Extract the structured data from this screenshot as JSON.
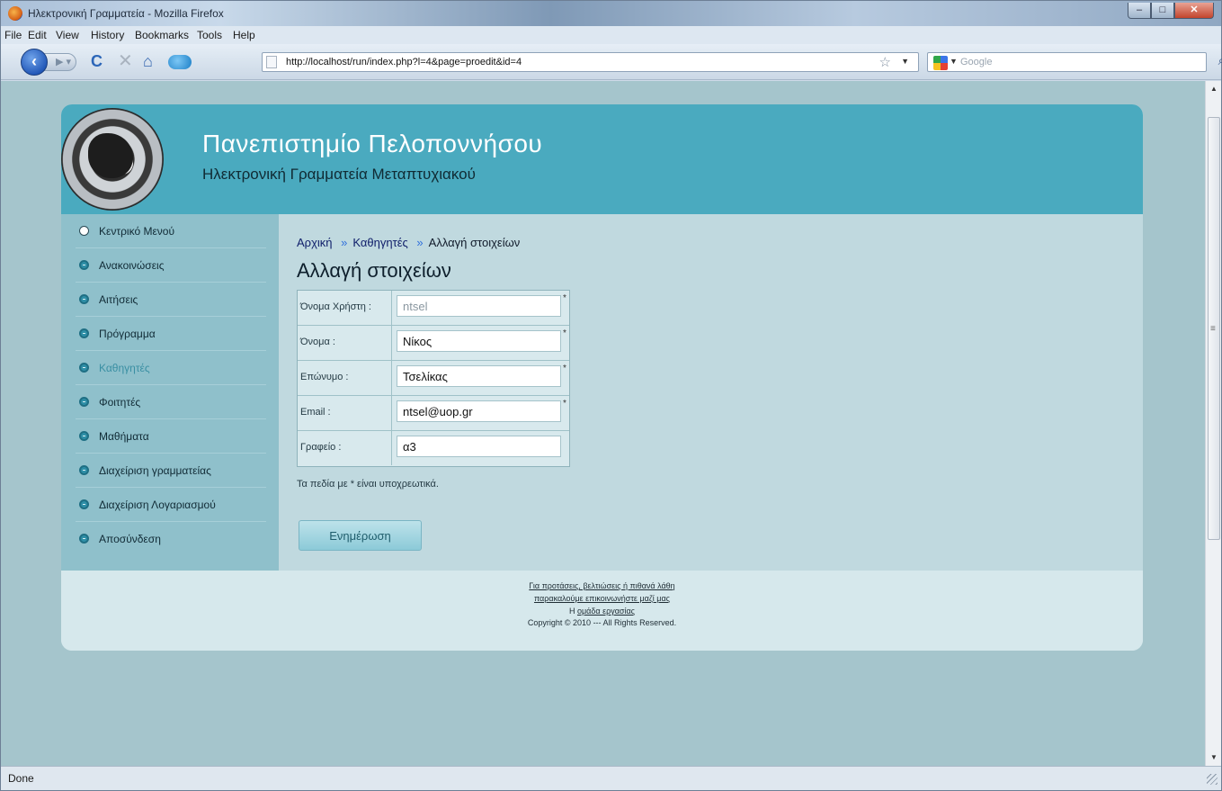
{
  "window": {
    "title": "Ηλεκτρονική Γραμματεία - Mozilla Firefox",
    "controls": {
      "minimize": "–",
      "maximize": "□",
      "close": "✕"
    }
  },
  "menubar": [
    "File",
    "Edit",
    "View",
    "History",
    "Bookmarks",
    "Tools",
    "Help"
  ],
  "navbar": {
    "url": "http://localhost/run/index.php?l=4&page=proedit&id=4",
    "search_placeholder": "Google",
    "icons": [
      "back-icon",
      "forward-icon",
      "reload-icon",
      "stop-icon",
      "home-icon",
      "chat-icon",
      "bookmark-star-icon",
      "search-icon"
    ]
  },
  "site": {
    "title": "Πανεπιστημίο Πελοποννήσου",
    "subtitle": "Ηλεκτρονική Γραμματεία Μεταπτυχιακού"
  },
  "sidebar": {
    "items": [
      {
        "label": "Κεντρικό Μενού"
      },
      {
        "label": "Ανακοινώσεις"
      },
      {
        "label": "Αιτήσεις"
      },
      {
        "label": "Πρόγραμμα"
      },
      {
        "label": "Καθηγητές"
      },
      {
        "label": "Φοιτητές"
      },
      {
        "label": "Μαθήματα"
      },
      {
        "label": "Διαχείριση γραμματείας"
      },
      {
        "label": "Διαχείριση Λογαριασμού"
      },
      {
        "label": "Αποσύνδεση"
      }
    ]
  },
  "breadcrumb": {
    "home": "Αρχική",
    "sep1": "»",
    "section": "Καθηγητές",
    "sep2": "»",
    "current": "Αλλαγή στοιχείων"
  },
  "page_title": "Αλλαγή στοιχείων",
  "form": {
    "fields": [
      {
        "label": "Όνομα Χρήστη :",
        "value": "ntsel",
        "required": "*"
      },
      {
        "label": "Όνομα :",
        "value": "Νίκος",
        "required": "*"
      },
      {
        "label": "Επώνυμο :",
        "value": "Τσελίκας",
        "required": "*"
      },
      {
        "label": "Email :",
        "value": "ntsel@uop.gr",
        "required": "*"
      },
      {
        "label": "Γραφείο :",
        "value": "α3",
        "required": ""
      }
    ],
    "note": "Τα πεδία με * είναι υποχρεωτικά.",
    "submit_label": "Ενημέρωση"
  },
  "footer": {
    "line1": "Για προτάσεις, βελτιώσεις ή πιθανά λάθη",
    "line2": "παρακαλούμε επικοινωνήστε μαζί μας",
    "line3_prefix": "Η",
    "line3_link": "ομάδα εργασίας",
    "copyright": "Copyright © 2010 --- All Rights Reserved."
  },
  "statusbar": {
    "text": "Done"
  }
}
